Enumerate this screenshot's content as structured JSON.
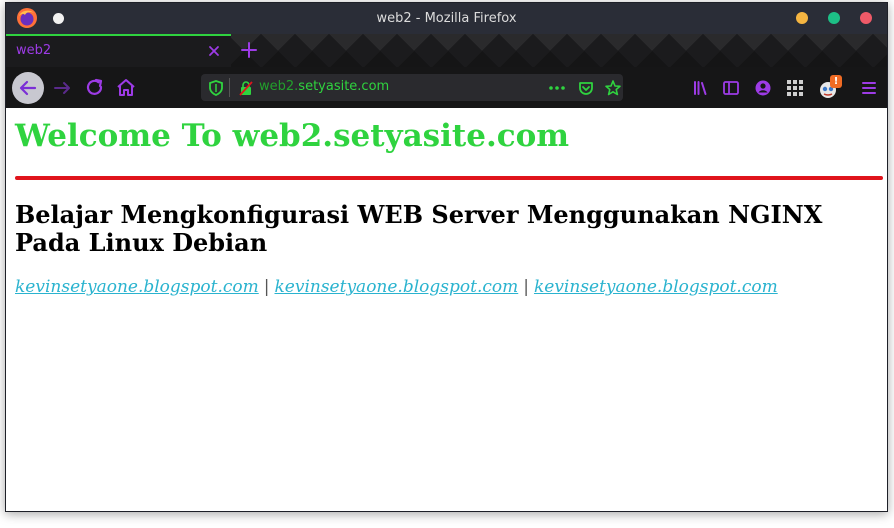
{
  "window": {
    "title": "web2 - Mozilla Firefox"
  },
  "tab": {
    "label": "web2"
  },
  "urlbar": {
    "subdomain": "web2.",
    "domain": "setyasite.com"
  },
  "page": {
    "heading": "Welcome To web2.setyasite.com",
    "subheading": "Belajar Mengkonfigurasi WEB Server Menggunakan NGINX Pada Linux Debian",
    "links": [
      "kevinsetyaone.blogspot.com",
      "kevinsetyaone.blogspot.com",
      "kevinsetyaone.blogspot.com"
    ],
    "separator": "|"
  },
  "colors": {
    "accent_green": "#2fd33f",
    "accent_purple": "#9d3be6",
    "divider_red": "#e0141c",
    "link_cyan": "#2ab3cf"
  },
  "icons": {
    "notification_badge": "!"
  }
}
